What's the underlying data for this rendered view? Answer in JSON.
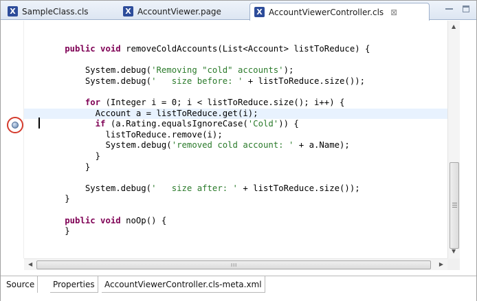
{
  "tabs": [
    {
      "label": "SampleClass.cls",
      "icon": "apex-class-icon"
    },
    {
      "label": "AccountViewer.page",
      "icon": "apex-page-icon"
    },
    {
      "label": "AccountViewerController.cls",
      "icon": "apex-class-icon",
      "active": true,
      "close": "⊠"
    }
  ],
  "code_lines": [
    [
      {
        "t": "        ",
        "c": "plain"
      },
      {
        "t": "public void",
        "c": "kw"
      },
      {
        "t": " removeColdAccounts(List<Account> listToReduce) {",
        "c": "plain"
      }
    ],
    [],
    [
      {
        "t": "            System.debug(",
        "c": "plain"
      },
      {
        "t": "'Removing \"cold\" accounts'",
        "c": "str"
      },
      {
        "t": ");",
        "c": "plain"
      }
    ],
    [
      {
        "t": "            System.debug(",
        "c": "plain"
      },
      {
        "t": "'   size before: '",
        "c": "str"
      },
      {
        "t": " + listToReduce.size());",
        "c": "plain"
      }
    ],
    [],
    [
      {
        "t": "            ",
        "c": "plain"
      },
      {
        "t": "for",
        "c": "kw"
      },
      {
        "t": " (Integer i = 0; i < listToReduce.size(); i++) {",
        "c": "plain"
      }
    ],
    [
      {
        "t": "              Account a = listToReduce.get(i);",
        "c": "plain"
      }
    ],
    [
      {
        "t": "              ",
        "c": "plain"
      },
      {
        "t": "if",
        "c": "kw"
      },
      {
        "t": " (a.Rating.equalsIgnoreCase(",
        "c": "plain"
      },
      {
        "t": "'Cold'",
        "c": "str"
      },
      {
        "t": ")) {",
        "c": "plain"
      }
    ],
    [
      {
        "t": "                listToReduce.remove(i);",
        "c": "plain"
      }
    ],
    [
      {
        "t": "                System.debug(",
        "c": "plain"
      },
      {
        "t": "'removed cold account: '",
        "c": "str"
      },
      {
        "t": " + a.Name);",
        "c": "plain"
      }
    ],
    [
      {
        "t": "              }",
        "c": "plain"
      }
    ],
    [
      {
        "t": "            }",
        "c": "plain"
      }
    ],
    [],
    [
      {
        "t": "            System.debug(",
        "c": "plain"
      },
      {
        "t": "'   size after: '",
        "c": "str"
      },
      {
        "t": " + listToReduce.size());",
        "c": "plain"
      }
    ],
    [
      {
        "t": "        }",
        "c": "plain"
      }
    ],
    [],
    [
      {
        "t": "        ",
        "c": "plain"
      },
      {
        "t": "public void",
        "c": "kw"
      },
      {
        "t": " noOp() {",
        "c": "plain"
      }
    ],
    [
      {
        "t": "        }",
        "c": "plain"
      }
    ]
  ],
  "current_line_index": 6,
  "hscroll_grip": "III",
  "bottom_tabs": [
    {
      "label": "Source",
      "active": true
    },
    {
      "label": "Properties"
    },
    {
      "label": "AccountViewerController.cls-meta.xml"
    }
  ],
  "colors": {
    "keyword": "#7f0055",
    "string": "#2a7a2a",
    "current_line": "#e8f2fe",
    "breakpoint_ring": "#d43a2c"
  }
}
